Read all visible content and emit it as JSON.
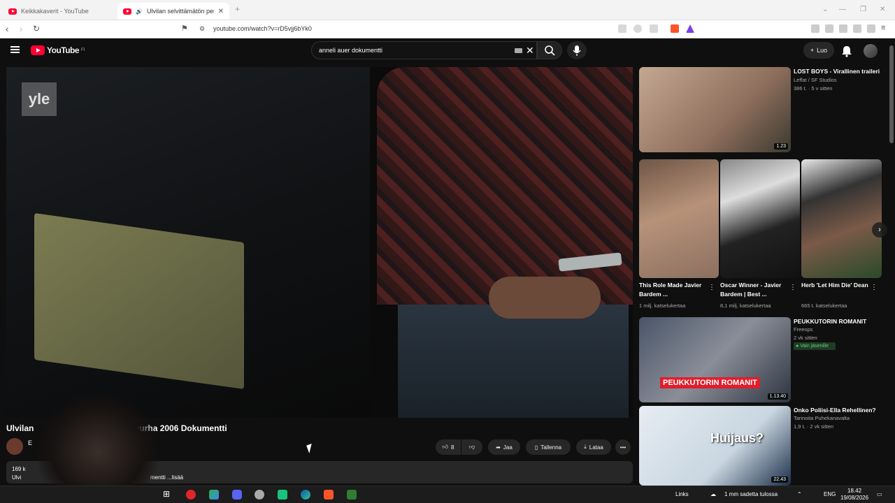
{
  "browser": {
    "tabs": [
      {
        "title": "Keikkakaverit - YouTube"
      },
      {
        "title": "Ulvilan selvittämätön perhee"
      }
    ],
    "url": "youtube.com/watch?v=rD5vjj6bYk0"
  },
  "header": {
    "logo_text": "YouTube",
    "logo_region": "FI",
    "search_value": "anneli auer dokumentti",
    "create_label": "Luo"
  },
  "player": {
    "watermark": "yle"
  },
  "video": {
    "title_left": "Ulvilan",
    "title_right": "isän murha 2006 Dokumentti",
    "channel_initial": "E",
    "like_count": "8",
    "share_label": "Jaa",
    "save_label": "Tallenna",
    "download_label": "Lataa",
    "desc_views": "169 k",
    "desc_line2": "Ulvi",
    "desc_more": "mentti ...lisää"
  },
  "sidebar": {
    "items": [
      {
        "title": "LOST BOYS - Virallinen traileri",
        "channel": "Leffat / SF Studios",
        "meta": "386 t. · 5 v sitten",
        "duration": "1.23"
      },
      {
        "title": "PEUKKUTORIN ROMANIT",
        "channel": "Freeops",
        "meta": "2 vk sitten",
        "badge": "Vain jäsenille",
        "thumb_text": "PEUKKUTORIN ROMANIT",
        "duration": "1.13.40"
      },
      {
        "title": "Onko Poliisi-Ella Rehellinen?",
        "channel": "Tarinoita Puhekanavalta",
        "meta": "1,9 t. · 2 vk sitten",
        "thumb_text": "Huijaus?",
        "duration": "22.43"
      }
    ],
    "shorts": [
      {
        "title": "This Role Made Javier Bardem ...",
        "views": "1 milj. katselukertaa"
      },
      {
        "title": "Oscar Winner - Javier Bardem | Best ...",
        "views": "8,1 milj. katselukertaa"
      },
      {
        "title": "Herb 'Let Him Die' Dean",
        "views": "665 t. katselukertaa"
      }
    ]
  },
  "taskbar": {
    "links_label": "Links",
    "weather": "1 mm sadetta tulossa",
    "lang": "ENG",
    "time": "18.42",
    "date": "19/08/2026"
  }
}
